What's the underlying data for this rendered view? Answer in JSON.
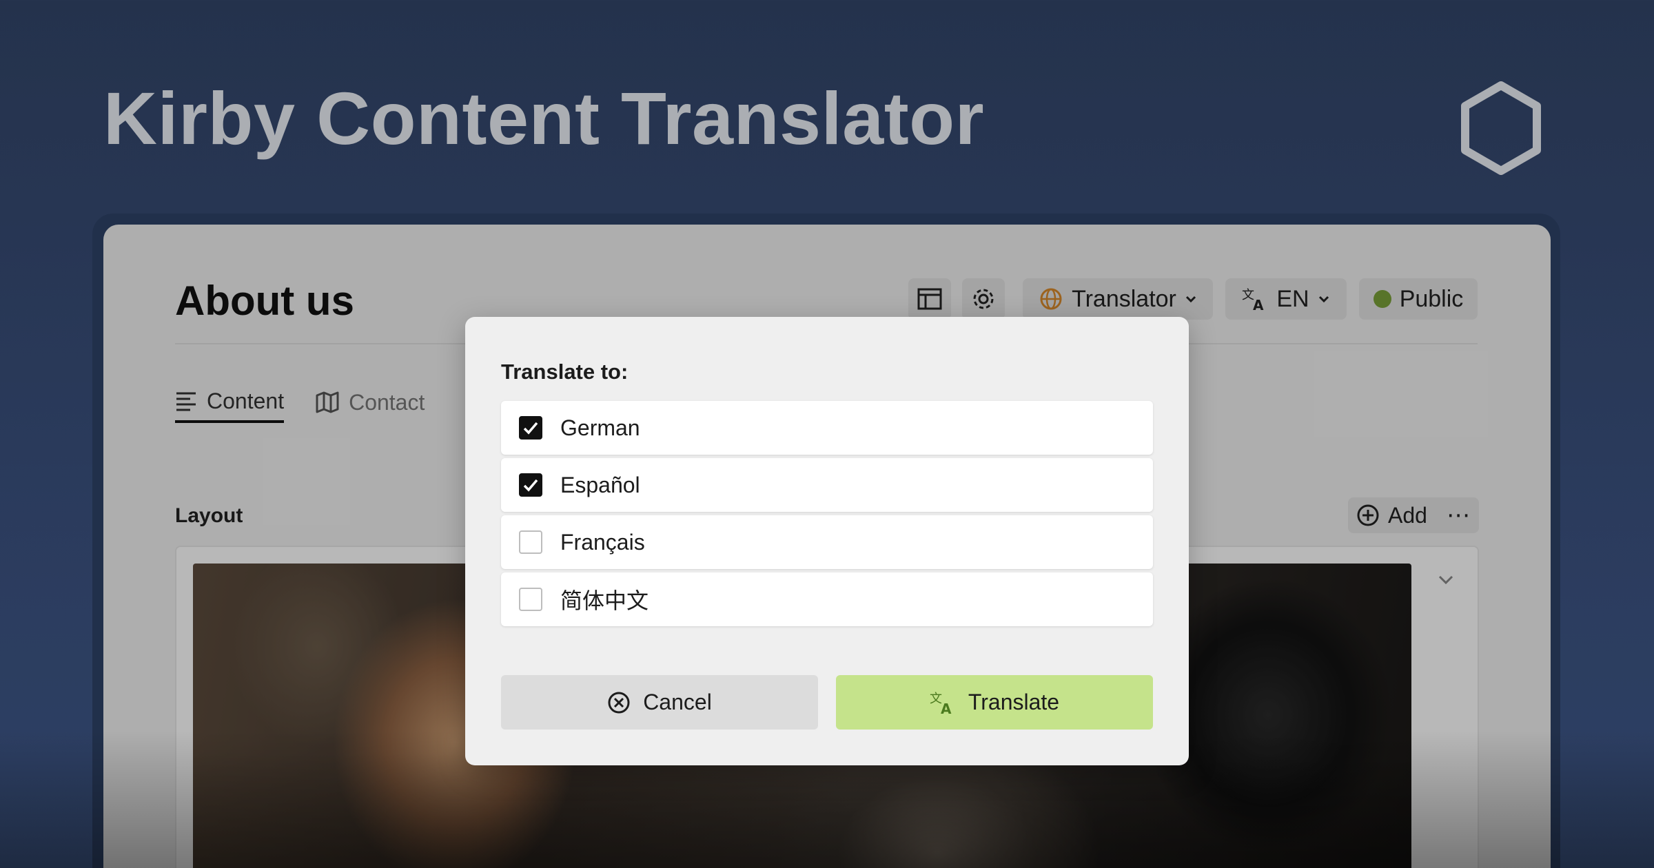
{
  "hero": {
    "title": "Kirby Content Translator"
  },
  "page": {
    "title": "About us",
    "header": {
      "translator_label": "Translator",
      "language_label": "EN",
      "status_label": "Public",
      "status_color": "#7aa13a"
    },
    "tabs": [
      {
        "label": "Content",
        "icon": "text-lines-icon",
        "active": true
      },
      {
        "label": "Contact",
        "icon": "map-icon",
        "active": false
      }
    ],
    "layout": {
      "label": "Layout",
      "add_label": "Add",
      "more_label": "⋯"
    }
  },
  "dialog": {
    "label": "Translate to:",
    "options": [
      {
        "label": "German",
        "checked": true
      },
      {
        "label": "Español",
        "checked": true
      },
      {
        "label": "Français",
        "checked": false
      },
      {
        "label": "简体中文",
        "checked": false
      }
    ],
    "cancel_label": "Cancel",
    "translate_label": "Translate",
    "translate_color": "#c5e38b"
  }
}
